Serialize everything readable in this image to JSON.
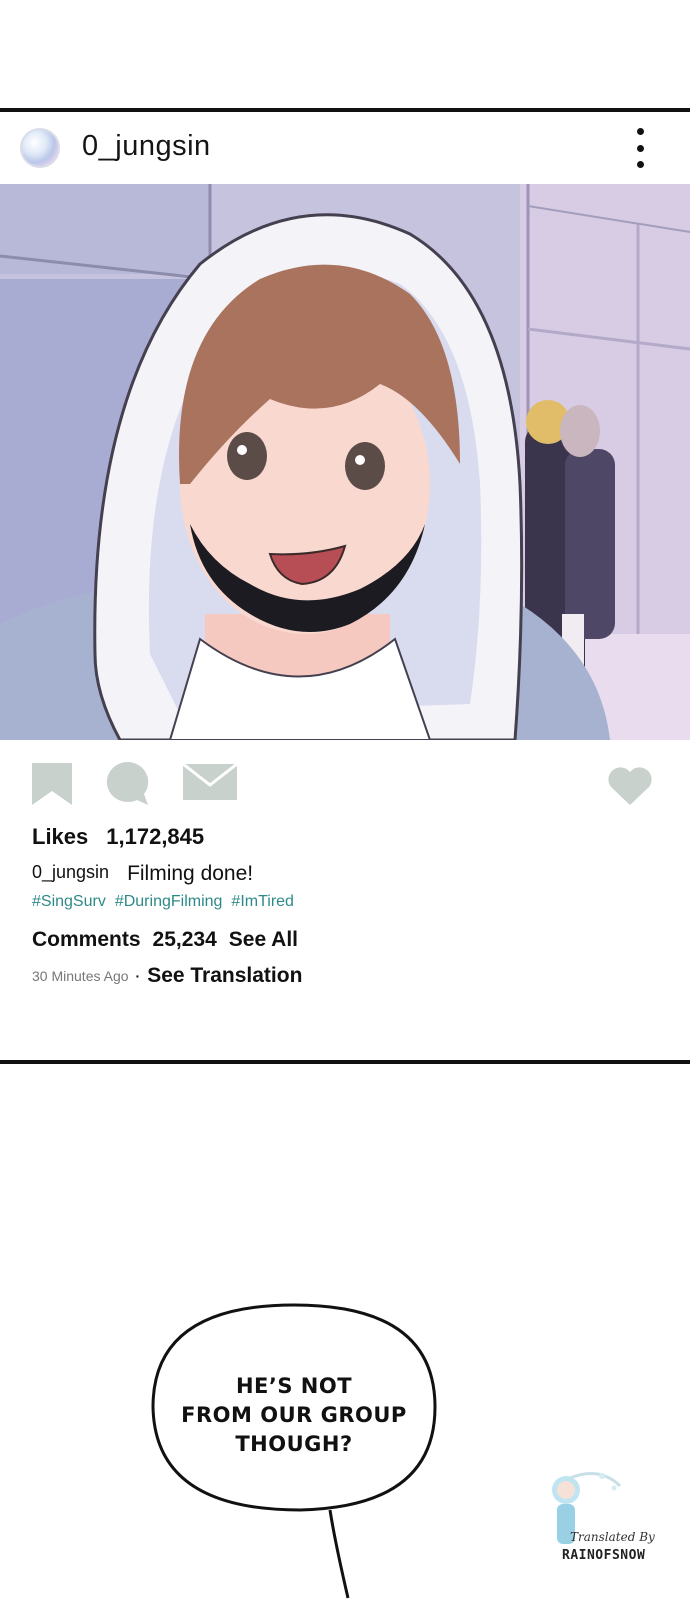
{
  "post": {
    "username": "0_jungsin",
    "avatar_icon": "avatar-icon",
    "menu_icon": "more-vertical-icon"
  },
  "photo": {
    "description_icon": "post-photo"
  },
  "actions": {
    "bookmark_icon": "bookmark-icon",
    "comment_icon": "comment-icon",
    "share_icon": "mail-icon",
    "like_icon": "heart-icon",
    "icon_color": "#c9d1cc"
  },
  "likes": {
    "label": "Likes",
    "count": "1,172,845"
  },
  "caption": {
    "username": "0_jungsin",
    "text": "Filming done!"
  },
  "hashtags": [
    "#SingSurv",
    "#DuringFilming",
    "#ImTired"
  ],
  "comments": {
    "label": "Comments",
    "count": "25,234",
    "see_all": "See All"
  },
  "meta": {
    "time_ago": "30 Minutes Ago",
    "separator": "·",
    "see_translation": "See Translation"
  },
  "speech_bubble": {
    "line1": "HE’S NOT",
    "line2": "FROM OUR GROUP",
    "line3": "THOUGH?"
  },
  "watermark": {
    "line1": "Translated By",
    "line2": "RAINOFSNOW"
  },
  "colors": {
    "hashtag": "#2e8a88",
    "frame": "#111111"
  }
}
